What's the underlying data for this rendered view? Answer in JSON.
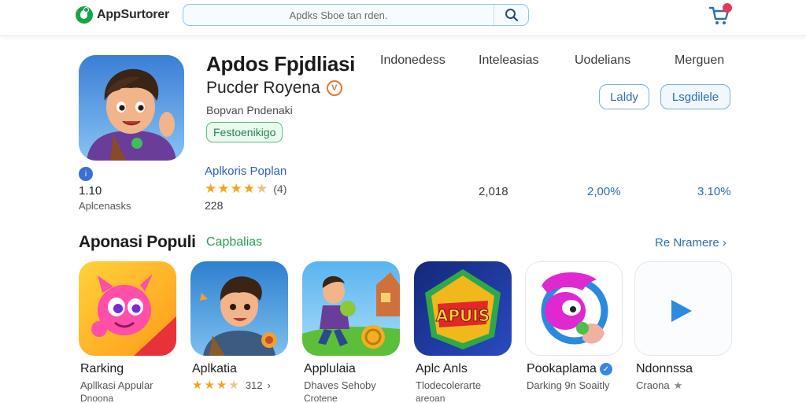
{
  "header": {
    "logo_text": "AppSurtorer",
    "search_placeholder": "Apdks Sboe tan rden.",
    "icons": [
      "logo-icon",
      "search-icon",
      "cart-icon"
    ]
  },
  "app": {
    "title": "Apdos Fpjdliasi",
    "developer": "Pucder Royena",
    "verified_mark": "V",
    "subtitle": "Bopvan Pndenaki",
    "tag": "Festoenikigo",
    "mini_value": "1.10",
    "mini_label": "Aplcenasks",
    "popular_label": "Aplkoris Poplan",
    "rating_count": "(4)",
    "rating": 4.5,
    "rank_number": "228"
  },
  "stats": {
    "headings": [
      "Indonedess",
      "Inteleasias",
      "Uodelians",
      "Merguen"
    ],
    "values": [
      "2,018",
      "2,00%",
      "3.10%"
    ]
  },
  "actions": {
    "primary_label": "Laldy",
    "secondary_label": "Lsgdilele"
  },
  "section": {
    "title": "Aponasi Populi",
    "subtitle": "Capbalias",
    "see_more": "Re Nramere"
  },
  "apps": [
    {
      "name": "Rarking",
      "line1": "Apllkasi Appular",
      "line2": "Dnoona",
      "icon": "pink-creature-icon"
    },
    {
      "name": "Aplkatia",
      "rating": 3.5,
      "rating_count": "312",
      "icon": "boy-adventure-icon"
    },
    {
      "name": "Applulaia",
      "line1": "Dhaves Sehoby",
      "line2": "Crotene",
      "icon": "runner-game-icon"
    },
    {
      "name": "Aplc Anls",
      "line1": "Tlodecolerarte",
      "line2": "areoan",
      "badge_text": "APUIS",
      "icon": "apuis-badge-icon"
    },
    {
      "name": "Pookaplama",
      "verified": true,
      "line1": "Darking 9n Soaitly",
      "icon": "magenta-character-icon"
    },
    {
      "name": "Ndonnssa",
      "line1": "Craona",
      "icon": "play-icon"
    }
  ],
  "colors": {
    "accent_blue": "#2d6db4",
    "green": "#2a9d55",
    "star": "#f2a51a",
    "badge_red": "#e23b5a"
  }
}
